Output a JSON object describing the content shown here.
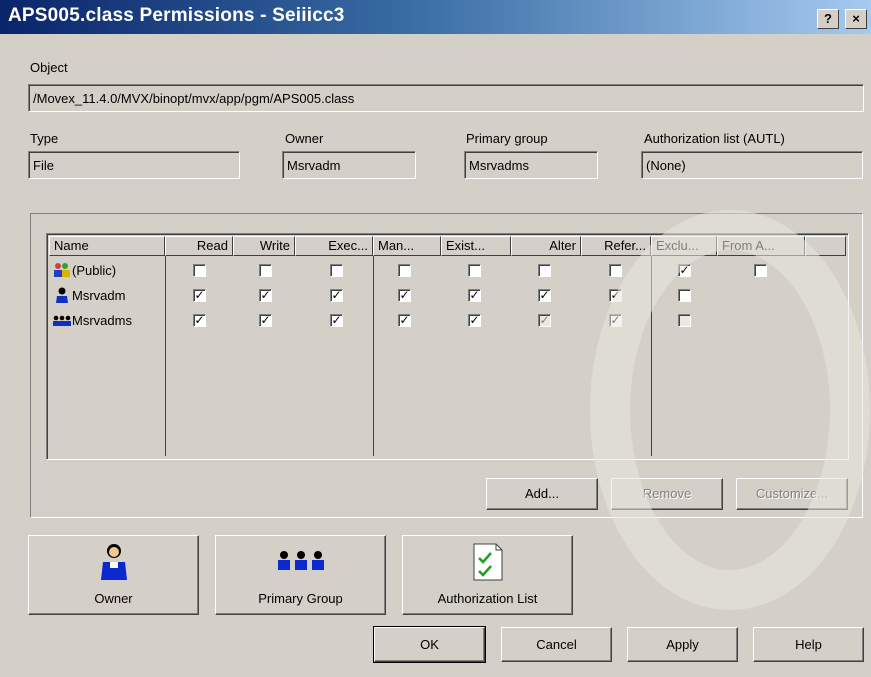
{
  "window": {
    "title": "APS005.class Permissions - Seiiicc3",
    "help_label": "?",
    "close_label": "×"
  },
  "object": {
    "label": "Object",
    "value": "/Movex_11.4.0/MVX/binopt/mvx/app/pgm/APS005.class"
  },
  "type": {
    "label": "Type",
    "value": "File"
  },
  "owner": {
    "label": "Owner",
    "value": "Msrvadm"
  },
  "primary_group": {
    "label": "Primary group",
    "value": "Msrvadms"
  },
  "autl": {
    "label": "Authorization list (AUTL)",
    "value": "(None)"
  },
  "list": {
    "headers": [
      "Name",
      "Read",
      "Write",
      "Exec...",
      "Man...",
      "Exist...",
      "Alter",
      "Refer...",
      "Exclu...",
      "From A..."
    ],
    "rows": [
      {
        "name": "(Public)",
        "icon": "public-icon",
        "checks": [
          false,
          false,
          false,
          false,
          false,
          false,
          false
        ],
        "exclude": true,
        "exclude_disabled": false,
        "from_autl": false
      },
      {
        "name": "Msrvadm",
        "icon": "user-icon",
        "checks": [
          true,
          true,
          true,
          true,
          true,
          true,
          true
        ],
        "exclude": false,
        "exclude_disabled": false
      },
      {
        "name": "Msrvadms",
        "icon": "group-icon",
        "checks": [
          true,
          true,
          true,
          true,
          true,
          true,
          true
        ],
        "alter_disabled": true,
        "exclude": false,
        "exclude_disabled": true
      }
    ]
  },
  "list_buttons": {
    "add": "Add...",
    "remove": "Remove",
    "customize": "Customize..."
  },
  "big_buttons": {
    "owner": "Owner",
    "primary_group": "Primary Group",
    "authorization_list": "Authorization List"
  },
  "dialog_buttons": {
    "ok": "OK",
    "cancel": "Cancel",
    "apply": "Apply",
    "help": "Help"
  },
  "colors": {
    "title_start": "#0a246a",
    "title_end": "#a6caf0",
    "face": "#d4d0c8"
  }
}
